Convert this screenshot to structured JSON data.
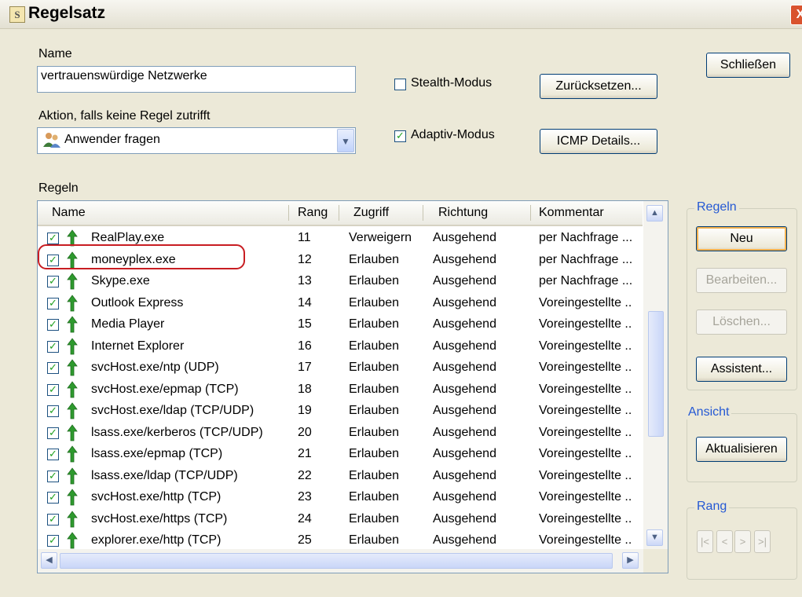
{
  "window": {
    "title": "Regelsatz",
    "app_icon_glyph": "S",
    "close_glyph": "X"
  },
  "name_label": "Name",
  "name_value": "vertrauenswürdige Netzwerke",
  "action_label": "Aktion, falls keine Regel zutrifft",
  "action_value": "Anwender fragen",
  "stealth": {
    "label": "Stealth-Modus",
    "checked": false
  },
  "adaptive": {
    "label": "Adaptiv-Modus",
    "checked": true
  },
  "buttons": {
    "close": "Schließen",
    "reset": "Zurücksetzen...",
    "icmp": "ICMP Details..."
  },
  "rules_label": "Regeln",
  "columns": [
    "Name",
    "Rang",
    "Zugriff",
    "Richtung",
    "Kommentar"
  ],
  "rows": [
    {
      "name": "RealPlay.exe",
      "rank": "11",
      "access": "Verweigern",
      "direction": "Ausgehend",
      "comment": "per Nachfrage ..."
    },
    {
      "name": "moneyplex.exe",
      "rank": "12",
      "access": "Erlauben",
      "direction": "Ausgehend",
      "comment": "per Nachfrage ..."
    },
    {
      "name": "Skype.exe",
      "rank": "13",
      "access": "Erlauben",
      "direction": "Ausgehend",
      "comment": "per Nachfrage ..."
    },
    {
      "name": "Outlook Express",
      "rank": "14",
      "access": "Erlauben",
      "direction": "Ausgehend",
      "comment": "Voreingestellte .."
    },
    {
      "name": "Media Player",
      "rank": "15",
      "access": "Erlauben",
      "direction": "Ausgehend",
      "comment": "Voreingestellte .."
    },
    {
      "name": "Internet Explorer",
      "rank": "16",
      "access": "Erlauben",
      "direction": "Ausgehend",
      "comment": "Voreingestellte .."
    },
    {
      "name": "svcHost.exe/ntp (UDP)",
      "rank": "17",
      "access": "Erlauben",
      "direction": "Ausgehend",
      "comment": "Voreingestellte .."
    },
    {
      "name": "svcHost.exe/epmap (TCP)",
      "rank": "18",
      "access": "Erlauben",
      "direction": "Ausgehend",
      "comment": "Voreingestellte .."
    },
    {
      "name": "svcHost.exe/ldap (TCP/UDP)",
      "rank": "19",
      "access": "Erlauben",
      "direction": "Ausgehend",
      "comment": "Voreingestellte .."
    },
    {
      "name": "lsass.exe/kerberos (TCP/UDP)",
      "rank": "20",
      "access": "Erlauben",
      "direction": "Ausgehend",
      "comment": "Voreingestellte .."
    },
    {
      "name": "lsass.exe/epmap (TCP)",
      "rank": "21",
      "access": "Erlauben",
      "direction": "Ausgehend",
      "comment": "Voreingestellte .."
    },
    {
      "name": "lsass.exe/ldap (TCP/UDP)",
      "rank": "22",
      "access": "Erlauben",
      "direction": "Ausgehend",
      "comment": "Voreingestellte .."
    },
    {
      "name": "svcHost.exe/http (TCP)",
      "rank": "23",
      "access": "Erlauben",
      "direction": "Ausgehend",
      "comment": "Voreingestellte .."
    },
    {
      "name": "svcHost.exe/https (TCP)",
      "rank": "24",
      "access": "Erlauben",
      "direction": "Ausgehend",
      "comment": "Voreingestellte .."
    },
    {
      "name": "explorer.exe/http (TCP)",
      "rank": "25",
      "access": "Erlauben",
      "direction": "Ausgehend",
      "comment": "Voreingestellte .."
    }
  ],
  "groups": {
    "rules": {
      "title": "Regeln",
      "new": "Neu",
      "edit": "Bearbeiten...",
      "delete": "Löschen...",
      "wizard": "Assistent..."
    },
    "view": {
      "title": "Ansicht",
      "refresh": "Aktualisieren"
    },
    "rank": {
      "title": "Rang",
      "first": "|<",
      "prev": "<",
      "next": ">",
      "last": ">|"
    }
  },
  "icons": {
    "check_glyph": "✓",
    "arrow_icon": "green-arrow-icon",
    "users_icon": "users-icon"
  },
  "colors": {
    "accent": "#2559d4",
    "highlight_ellipse": "#c81d22",
    "arrow_green": "#2e9a2e"
  }
}
